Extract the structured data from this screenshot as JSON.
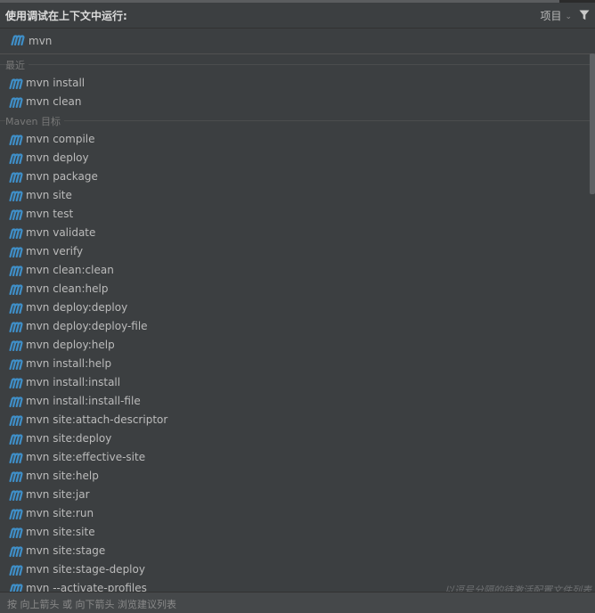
{
  "header": {
    "title": "使用调试在上下文中运行:",
    "scope_label": "项目",
    "filter_icon": "filter-icon"
  },
  "search": {
    "value": "mvn",
    "icon": "maven-icon"
  },
  "groups": {
    "recent": {
      "title": "最近",
      "items": [
        "mvn install",
        "mvn clean"
      ]
    },
    "goals": {
      "title": "Maven 目标",
      "items": [
        "mvn compile",
        "mvn deploy",
        "mvn package",
        "mvn site",
        "mvn test",
        "mvn validate",
        "mvn verify",
        "mvn clean:clean",
        "mvn clean:help",
        "mvn deploy:deploy",
        "mvn deploy:deploy-file",
        "mvn deploy:help",
        "mvn install:help",
        "mvn install:install",
        "mvn install:install-file",
        "mvn site:attach-descriptor",
        "mvn site:deploy",
        "mvn site:effective-site",
        "mvn site:help",
        "mvn site:jar",
        "mvn site:run",
        "mvn site:site",
        "mvn site:stage",
        "mvn site:stage-deploy",
        "mvn --activate-profiles"
      ]
    }
  },
  "hint_right": "以逗号分隔的待激活配置文件列表",
  "footer": {
    "hint": "按 向上箭头 或 向下箭头 浏览建议列表"
  },
  "colors": {
    "background": "#3c3f41",
    "maven_icon": "#3f8fc8",
    "text": "#bbbbbb"
  }
}
